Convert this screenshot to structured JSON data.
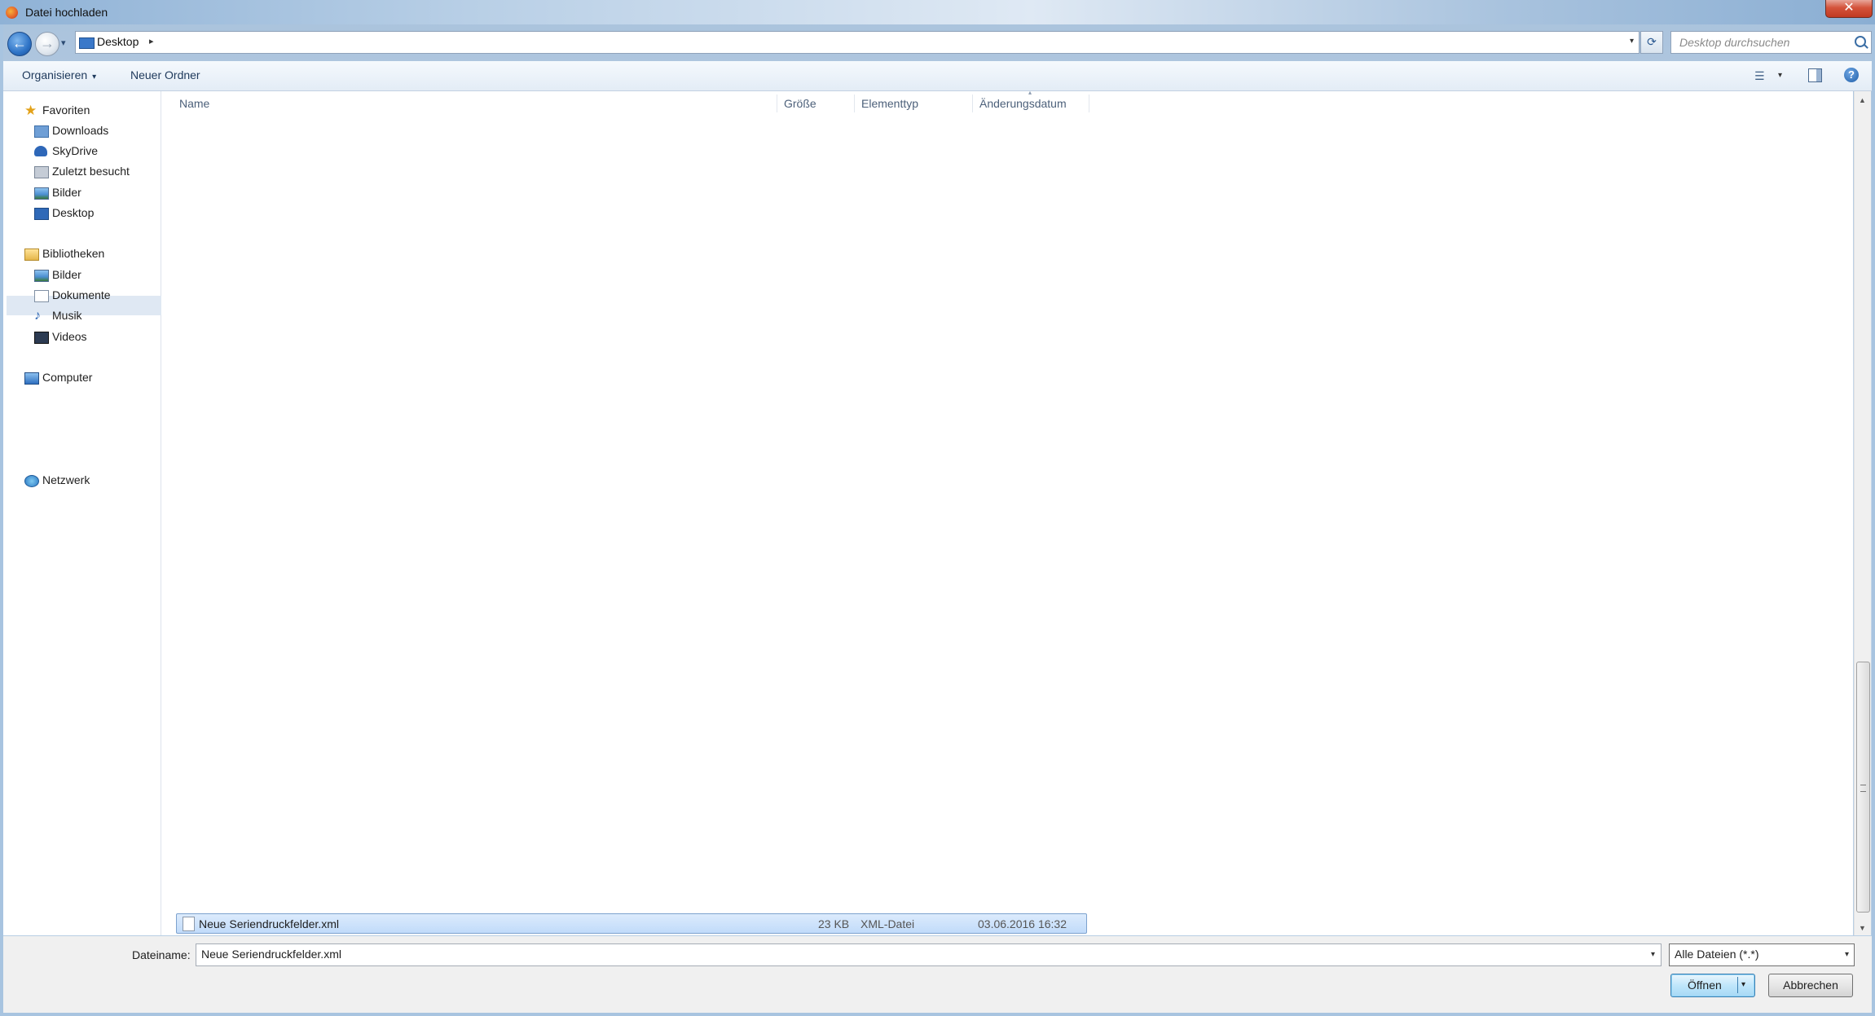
{
  "window": {
    "title": "Datei hochladen",
    "close_glyph": "✕"
  },
  "nav_buttons": {
    "back_glyph": "←",
    "forward_glyph": "→",
    "recent_glyph": "▾"
  },
  "address": {
    "path": "Desktop",
    "separator": "▸",
    "dropdown_glyph": "▾",
    "refresh_glyph": "⟳"
  },
  "search": {
    "placeholder": "Desktop durchsuchen"
  },
  "toolbar": {
    "organize_label": "Organisieren",
    "organize_caret": "▾",
    "new_folder_label": "Neuer Ordner",
    "view_glyph": "☰",
    "view_caret": "▾",
    "help_glyph": "?"
  },
  "sidebar": {
    "favorites": {
      "label": "Favoriten",
      "items": [
        {
          "label": "Downloads",
          "icon": "downloads-folder-icon"
        },
        {
          "label": "SkyDrive",
          "icon": "skydrive-icon"
        },
        {
          "label": "Zuletzt besucht",
          "icon": "recent-places-icon"
        },
        {
          "label": "Bilder",
          "icon": "pictures-icon"
        },
        {
          "label": "Desktop",
          "icon": "desktop-icon",
          "selected": true
        }
      ]
    },
    "libraries": {
      "label": "Bibliotheken",
      "items": [
        {
          "label": "Bilder",
          "icon": "pictures-icon"
        },
        {
          "label": "Dokumente",
          "icon": "documents-icon"
        },
        {
          "label": "Musik",
          "icon": "music-icon"
        },
        {
          "label": "Videos",
          "icon": "videos-icon"
        }
      ]
    },
    "computer": {
      "label": "Computer"
    },
    "network": {
      "label": "Netzwerk"
    },
    "star_glyph": "★",
    "note_glyph": "♪"
  },
  "file_list": {
    "columns": [
      "Name",
      "Größe",
      "Elementtyp",
      "Änderungsdatum"
    ],
    "sort_glyph": "▴",
    "rows": [
      {
        "name": "Neue Seriendruckfelder.xml",
        "size": "23 KB",
        "type": "XML-Datei",
        "modified": "03.06.2016 16:32",
        "selected": true
      }
    ]
  },
  "scrollbar": {
    "up_glyph": "▲",
    "down_glyph": "▼"
  },
  "bottom": {
    "filename_label": "Dateiname:",
    "filename_value": "Neue Seriendruckfelder.xml",
    "filename_drop": "▾",
    "filetype_value": "Alle Dateien (*.*)",
    "filetype_drop": "▾",
    "open_label": "Öffnen",
    "open_drop": "▾",
    "cancel_label": "Abbrechen"
  }
}
